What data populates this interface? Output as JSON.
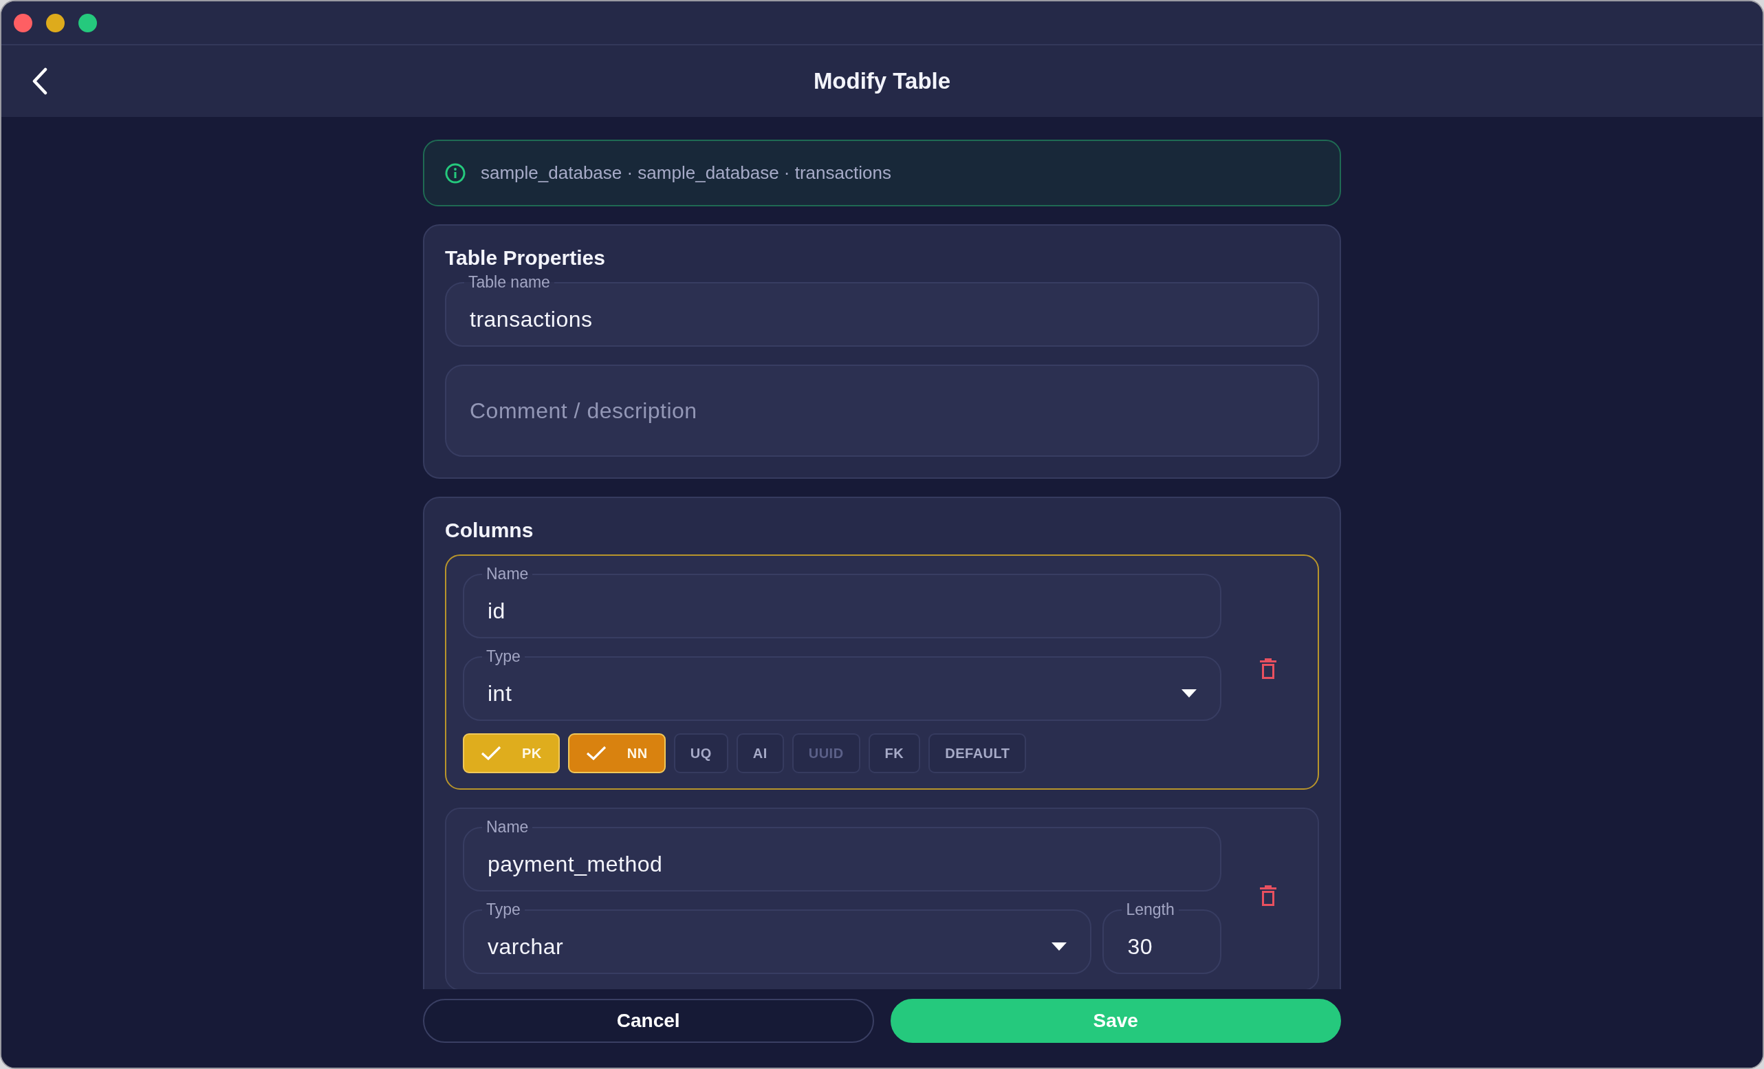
{
  "window": {
    "title": "Modify Table"
  },
  "breadcrumb": "sample_database · sample_database · transactions",
  "table_properties": {
    "heading": "Table Properties",
    "table_name": {
      "label": "Table name",
      "value": "transactions"
    },
    "comment": {
      "placeholder": "Comment / description"
    }
  },
  "columns": {
    "heading": "Columns",
    "items": [
      {
        "selected": true,
        "name": {
          "label": "Name",
          "value": "id"
        },
        "type": {
          "label": "Type",
          "value": "int"
        },
        "flags": [
          {
            "label": "PK",
            "checked": true,
            "disabled": false,
            "color": "#dfad1d"
          },
          {
            "label": "NN",
            "checked": true,
            "disabled": false,
            "color": "#d9820f"
          },
          {
            "label": "UQ",
            "checked": false,
            "disabled": false
          },
          {
            "label": "AI",
            "checked": false,
            "disabled": false
          },
          {
            "label": "UUID",
            "checked": false,
            "disabled": true
          },
          {
            "label": "FK",
            "checked": false,
            "disabled": false
          },
          {
            "label": "DEFAULT",
            "checked": false,
            "disabled": false
          }
        ]
      },
      {
        "selected": false,
        "name": {
          "label": "Name",
          "value": "payment_method"
        },
        "type": {
          "label": "Type",
          "value": "varchar"
        },
        "length": {
          "label": "Length",
          "value": "30"
        }
      }
    ]
  },
  "buttons": [
    {
      "label": "Cancel",
      "kind": "secondary"
    },
    {
      "label": "Save",
      "kind": "primary"
    }
  ]
}
